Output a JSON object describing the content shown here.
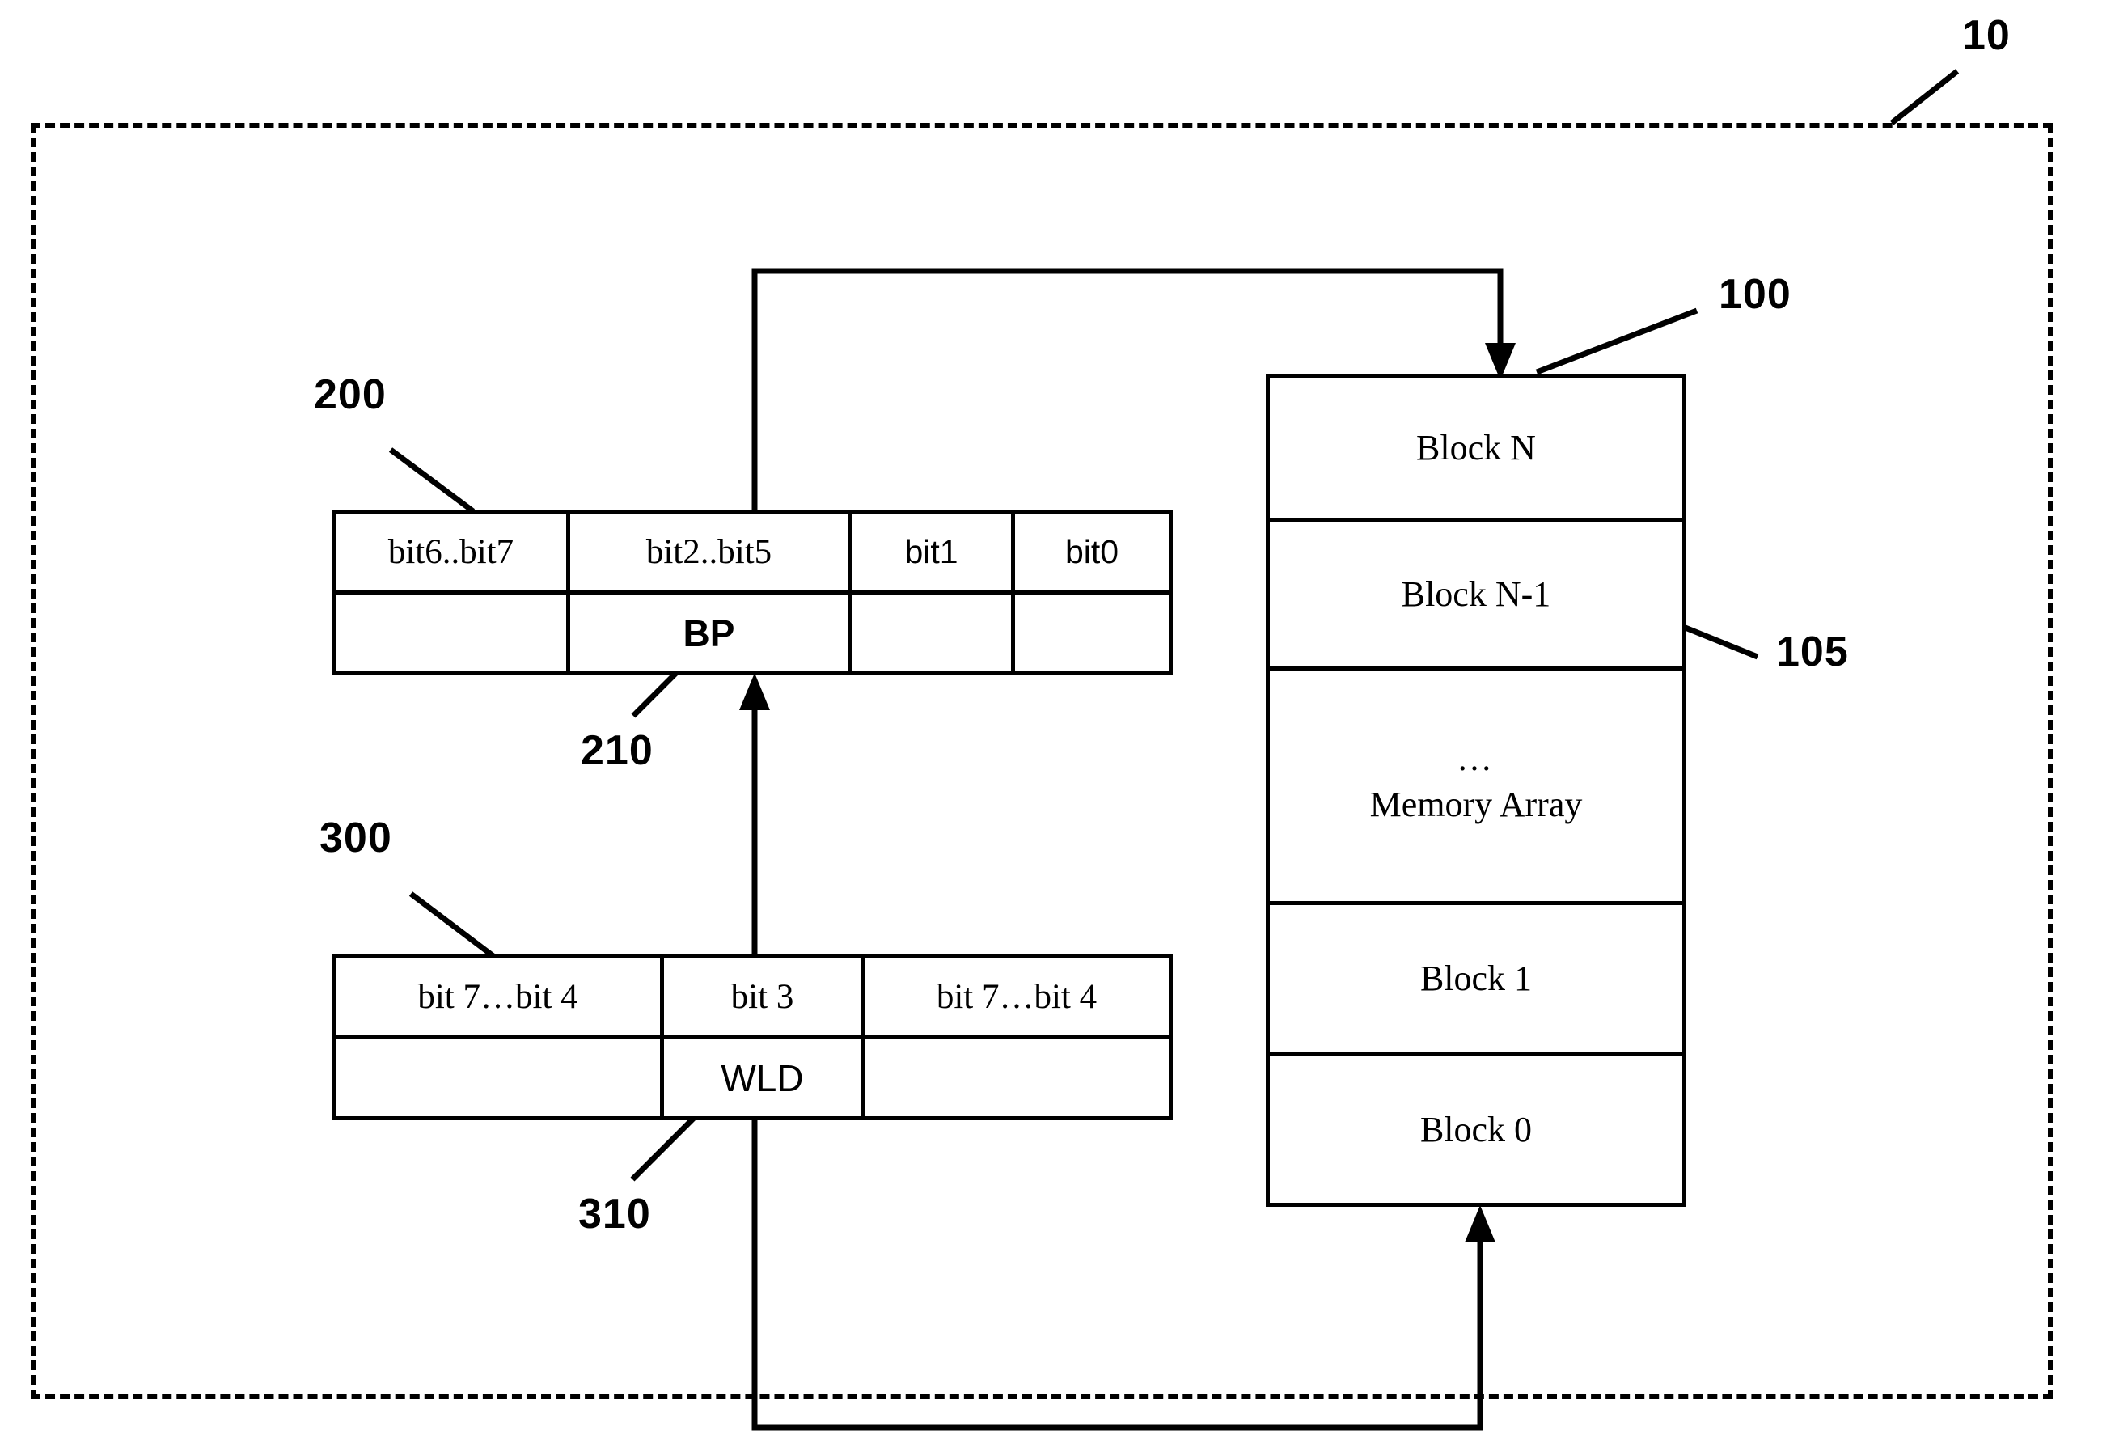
{
  "figure": {
    "enclosure_ref": "10",
    "memory_device_ref": "100",
    "block_ref": "105",
    "register_200_ref": "200",
    "bp_ref": "210",
    "register_300_ref": "300",
    "wld_ref": "310"
  },
  "register_200": {
    "top_row": [
      "bit6..bit7",
      "bit2..bit5",
      "bit1",
      "bit0"
    ],
    "bottom_row": [
      "",
      "BP",
      "",
      ""
    ]
  },
  "register_300": {
    "top_row": [
      "bit 7…bit 4",
      "bit 3",
      "bit 7…bit 4"
    ],
    "bottom_row": [
      "",
      "WLD",
      ""
    ]
  },
  "memory_array": {
    "blocks": [
      {
        "label": "Block N",
        "dots": ""
      },
      {
        "label": "Block N-1",
        "dots": ""
      },
      {
        "label": "Memory Array",
        "dots": "…"
      },
      {
        "label": "Block 1",
        "dots": ""
      },
      {
        "label": "Block 0",
        "dots": ""
      }
    ]
  },
  "colors": {
    "line": "#000000",
    "background": "#ffffff"
  }
}
